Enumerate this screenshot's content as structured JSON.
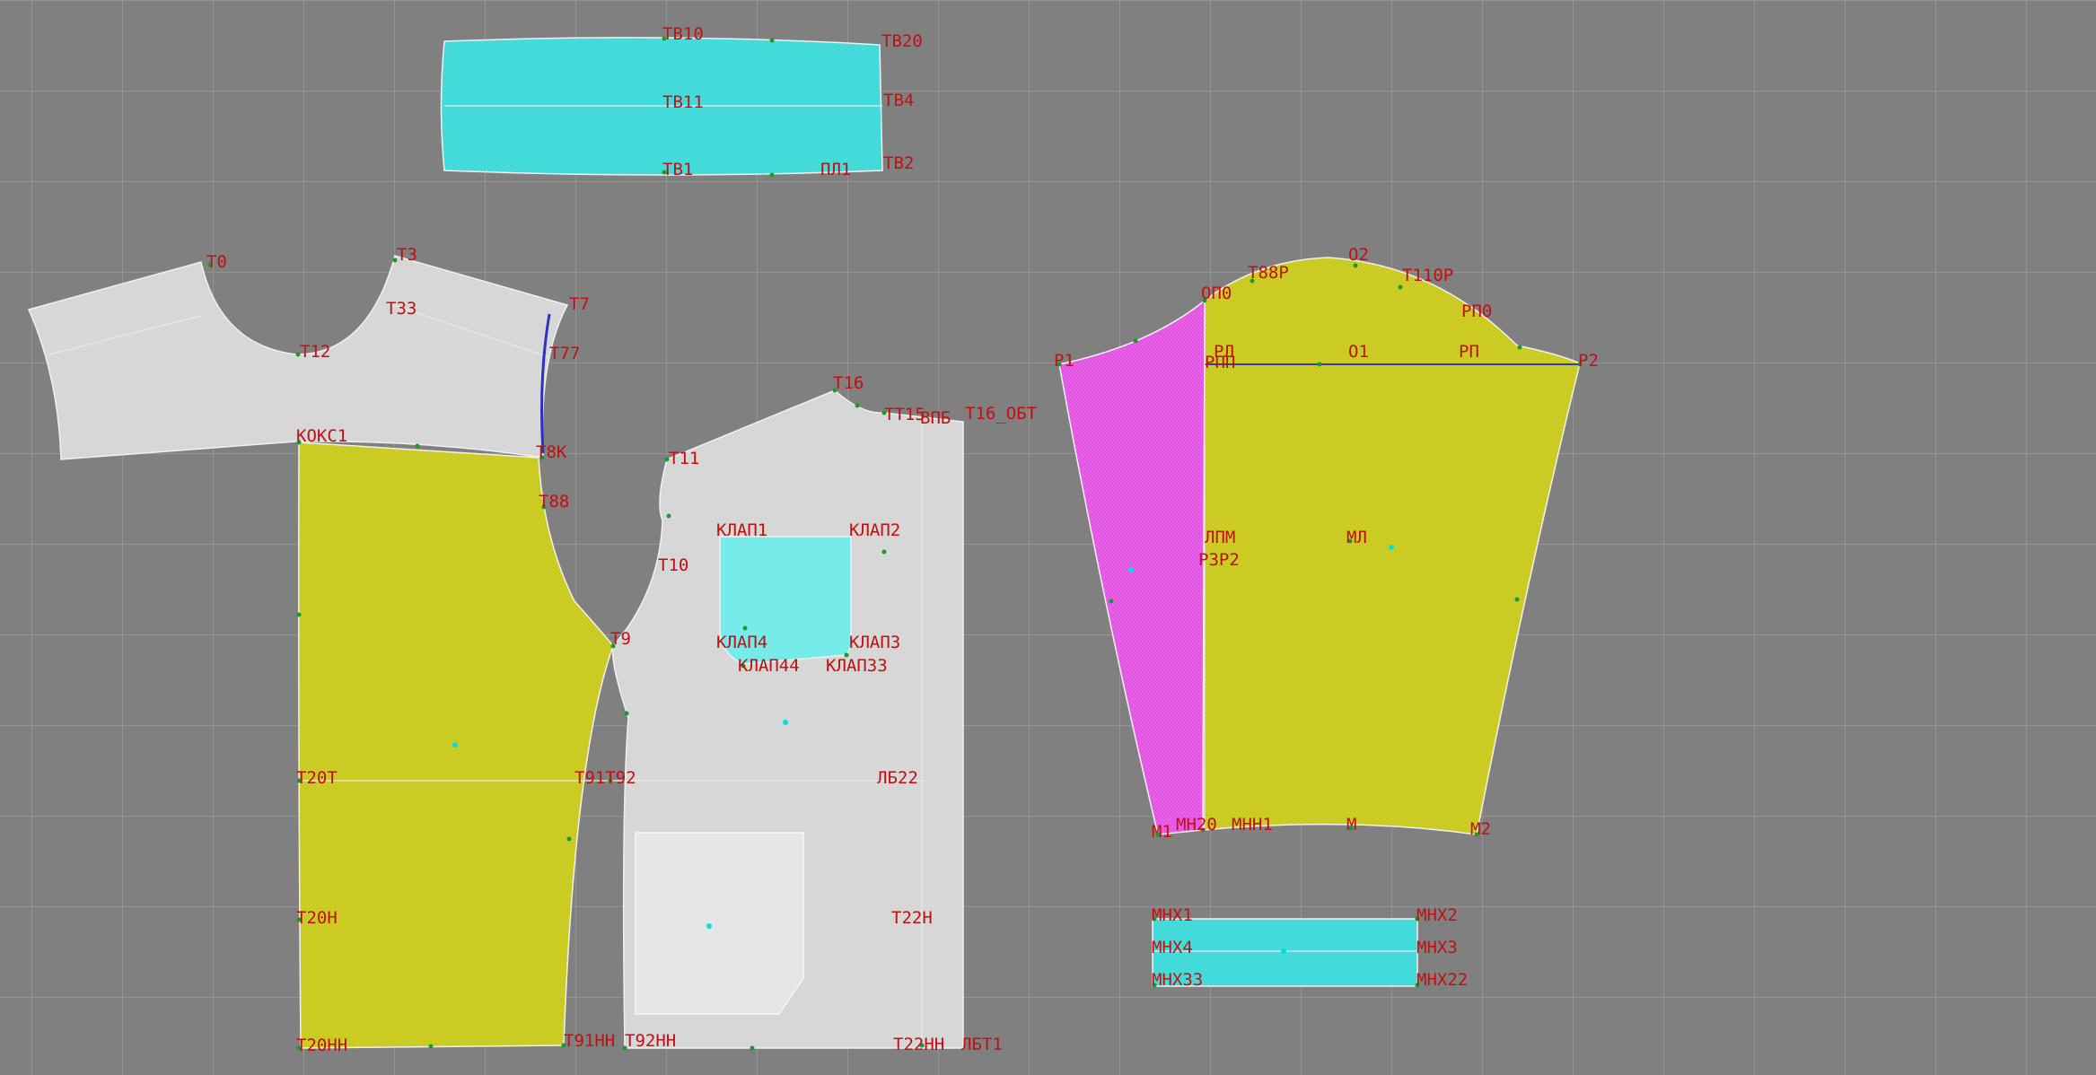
{
  "colors": {
    "background": "#808080",
    "grid": "#9a9a9a",
    "grey_piece": "#d4d4d4",
    "yellow_piece": "#c8c81a",
    "cyan_piece": "#3ad7d7",
    "magenta_piece": "#e052e0",
    "label": "#c01010",
    "point": "#1a9a2a"
  },
  "pieces": {
    "waistband": "waistband",
    "back_yoke": "back-yoke",
    "back": "back",
    "front": "front",
    "flap": "pocket-flap",
    "pocket": "pocket",
    "sleeve": "sleeve",
    "sleeve_gusset": "sleeve-gusset",
    "cuff": "cuff"
  },
  "labels": {
    "tb10": "ТВ10",
    "tb20": "ТВ20",
    "tb11": "ТВ11",
    "tb4": "ТВ4",
    "tb1": "ТВ1",
    "pl1": "ПЛ1",
    "tb2": "ТВ2",
    "t0": "Т0",
    "t3": "Т3",
    "t33": "Т33",
    "t7": "Т7",
    "t77": "Т77",
    "t12": "Т12",
    "koks1": "КОКС1",
    "t8k": "Т8К",
    "t88": "Т88",
    "t9": "Т9",
    "t20t": "Т20Т",
    "t91t92": "Т91Т92",
    "t20n": "Т20Н",
    "t20nn": "Т20НН",
    "t91nn": "Т91НН",
    "t16": "Т16",
    "t15": "ТТ15",
    "bpb": "ВПБ",
    "t16obt": "Т16_ОБТ",
    "t11": "Т11",
    "t10": "Т10",
    "klap1": "КЛАП1",
    "klap2": "КЛАП2",
    "klap4": "КЛАП4",
    "klap3": "КЛАП3",
    "klap44": "КЛАП44",
    "klap33": "КЛАП33",
    "lb22": "ЛБ22",
    "t22n": "Т22Н",
    "t92nn": "Т92НН",
    "t22nn": "Т22НН",
    "lbt1": "ЛБТ1",
    "o2": "О2",
    "t88r": "Т88Р",
    "t110r": "Т110Р",
    "rpo": "РП0",
    "ppo": "ОП0",
    "r1": "Р1",
    "rl": "РЛ",
    "rpp": "РПП",
    "o1": "О1",
    "rp": "РП",
    "r2": "Р2",
    "lpm": "ЛПМ",
    "rsr2": "РЗР2",
    "ml": "МЛ",
    "m1": "М1",
    "mn2": "МН20",
    "mnn1": "МНН1",
    "m": "М",
    "m2": "М2",
    "mnx1": "МНХ1",
    "mnx2": "МНХ2",
    "mnx4": "МНХ4",
    "mnx3": "МНХ3",
    "mnx33": "МНХ33",
    "mnx22": "МНХ22"
  }
}
